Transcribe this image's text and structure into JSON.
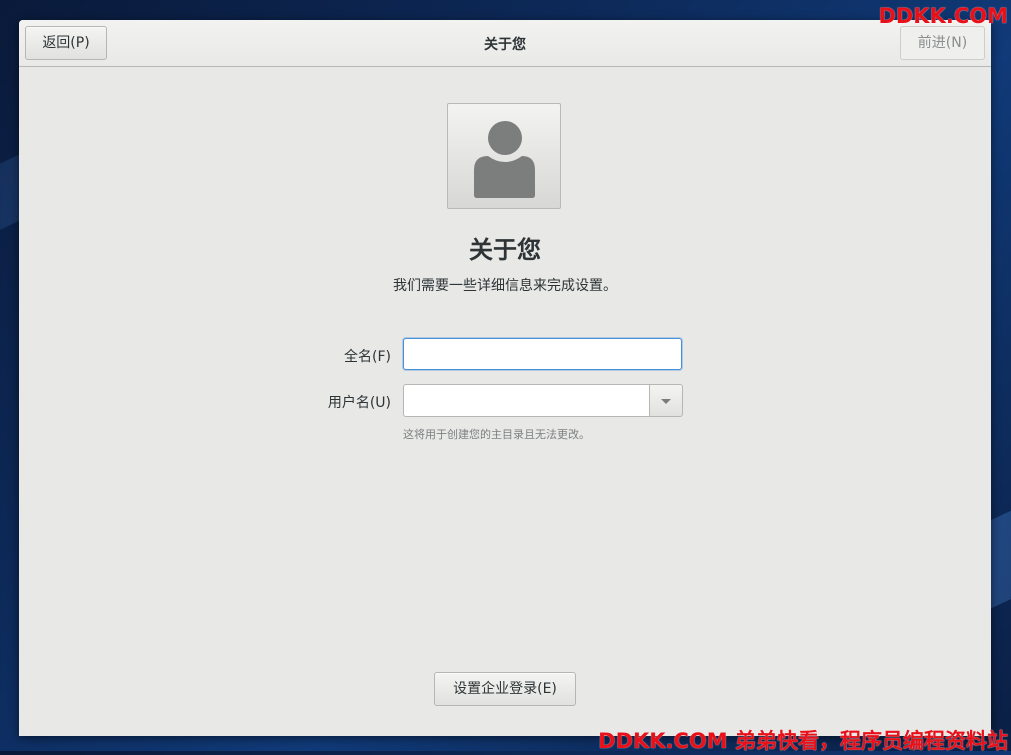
{
  "window": {
    "header_title": "关于您",
    "back_label": "返回(P)",
    "next_label": "前进(N)"
  },
  "page": {
    "heading": "关于您",
    "subtitle": "我们需要一些详细信息来完成设置。"
  },
  "form": {
    "fullname_label": "全名(F)",
    "fullname_value": "",
    "username_label": "用户名(U)",
    "username_value": "",
    "username_hint": "这将用于创建您的主目录且无法更改。"
  },
  "footer": {
    "enterprise_login_label": "设置企业登录(E)"
  },
  "watermark": {
    "top": "DDKK.COM",
    "bottom": "DDKK.COM 弟弟快看，程序员编程资料站"
  },
  "colors": {
    "focus_accent": "#4a90d9",
    "window_bg": "#e8e8e7",
    "watermark": "#e8111a"
  },
  "icons": {
    "avatar": "user-avatar-icon",
    "combo": "chevron-down-icon"
  }
}
